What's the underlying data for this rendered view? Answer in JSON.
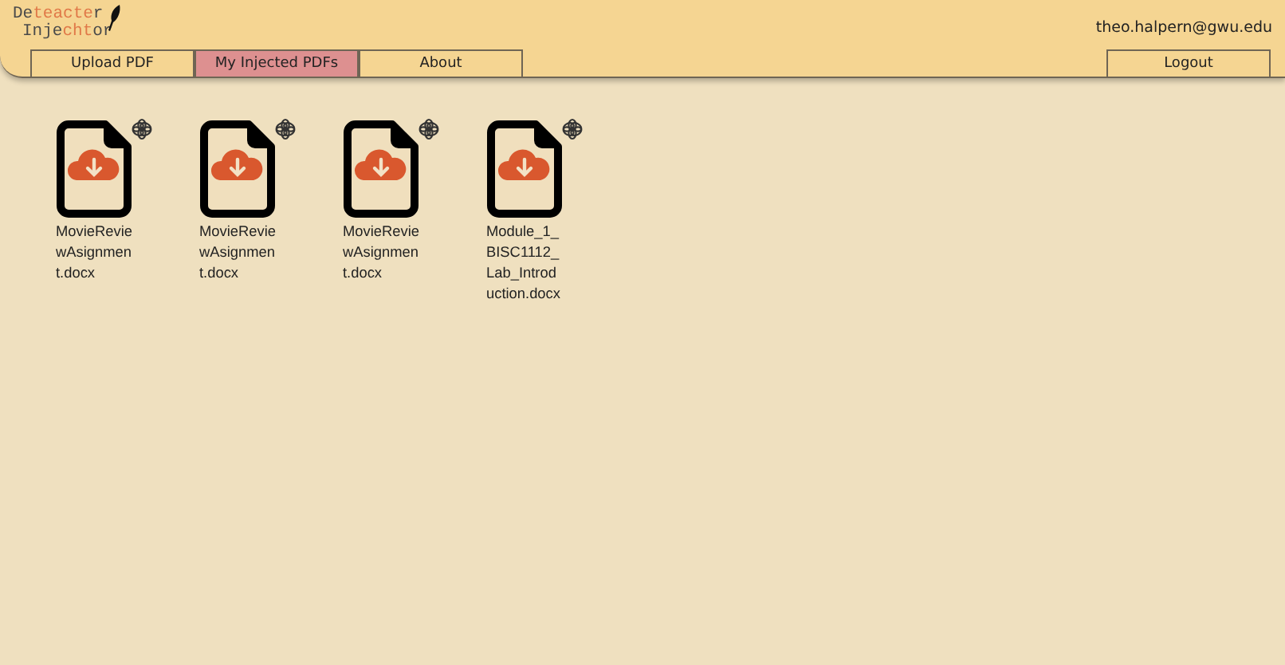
{
  "logo": {
    "lines": [
      [
        {
          "text": "De",
          "accent": false
        },
        {
          "text": "teacte",
          "accent": true
        },
        {
          "text": "r",
          "accent": false
        }
      ],
      [
        {
          "text": "Inje",
          "accent": false
        },
        {
          "text": "cht",
          "accent": true
        },
        {
          "text": "or",
          "accent": false
        }
      ]
    ]
  },
  "user_email": "theo.halpern@gwu.edu",
  "tabs": [
    {
      "label": "Upload PDF",
      "selected": false
    },
    {
      "label": "My Injected PDFs",
      "selected": true
    },
    {
      "label": "About",
      "selected": false
    }
  ],
  "logout": "Logout",
  "files": [
    {
      "name": "MovieReviewAsignment.docx"
    },
    {
      "name": "MovieReviewAsignment.docx"
    },
    {
      "name": "MovieReviewAsignment.docx"
    },
    {
      "name": "Module_1_BISC1112_Lab_Introduction.docx"
    }
  ]
}
